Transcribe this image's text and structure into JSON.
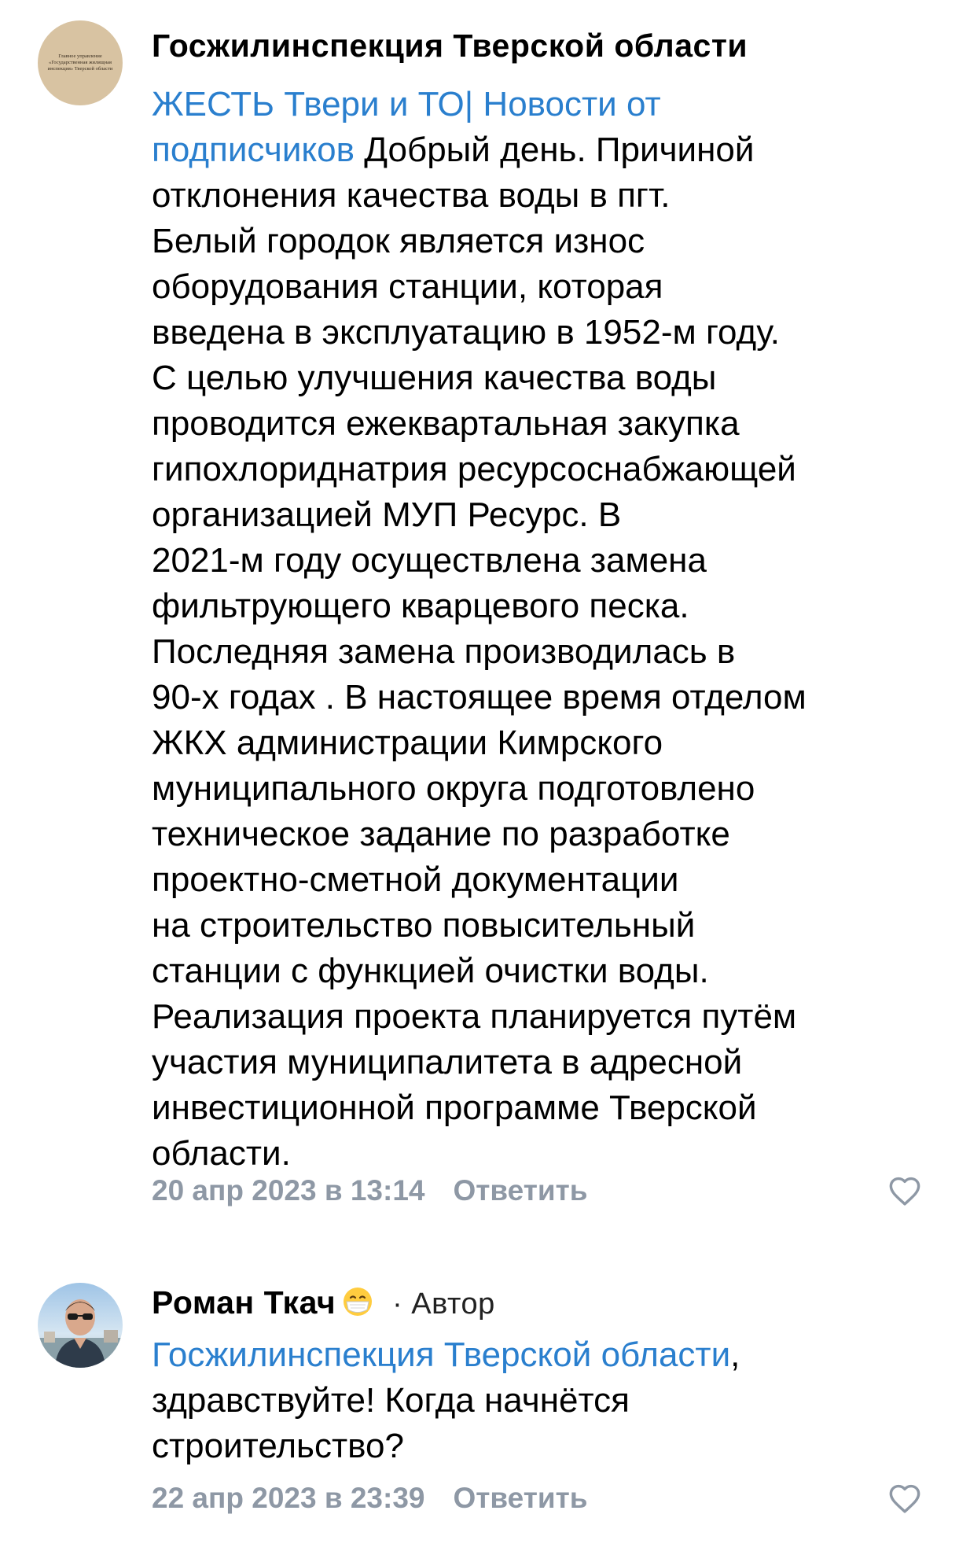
{
  "comments": [
    {
      "author": "Госжилинспекция Тверской области",
      "avatar_text": "Главное управление «Государственная жилищная инспекция» Тверской области",
      "mention": "ЖЕСТЬ Твери и ТО| Новости от подписчиков",
      "lines": [
        "ЖЕСТЬ Твери и ТО| Новости от",
        "подписчиков",
        " Добрый день. Причиной",
        "отклонения качества воды в пгт.",
        "Белый городок является износ",
        "оборудования станции, которая",
        "введена в эксплуатацию в 1952-м году.",
        "С целью улучшения качества воды",
        "проводится ежеквартальная закупка",
        "гипохлоридна­трия ресурсоснабжающей",
        "организацией МУП Ресурс. В",
        "2021-м году осуществлена замена",
        "фильтрующего кварцевого песка.",
        "Последняя замена производилась в",
        "90-х годах . В настоящее время отделом",
        "ЖКХ администрации Кимрского",
        "муниципального округа подготовлено",
        "техническое задание по разработке",
        "проектно-сметной документации",
        "на строительство повысительный",
        "станции с функцией очистки воды.",
        "Реализация проекта планируется путём",
        "участия муниципалитета в адресной",
        "инвестиционной программе Тверской",
        "области."
      ],
      "date": "20 апр 2023 в 13:14",
      "reply_label": "Ответить",
      "like_icon": "heart-outline-icon"
    },
    {
      "author": "Роман Ткач",
      "author_emoji": "😷",
      "role": "· Автор",
      "mention": "Госжилинспекция Тверской области",
      "after_mention": ",",
      "lines": [
        "здравствуйте! Когда начнётся",
        "строительство?"
      ],
      "date": "22 апр 2023 в 23:39",
      "reply_label": "Ответить",
      "like_icon": "heart-outline-icon"
    }
  ],
  "colors": {
    "link": "#2a7fce",
    "meta": "#8e98a5",
    "text": "#000000",
    "background": "#ffffff"
  }
}
